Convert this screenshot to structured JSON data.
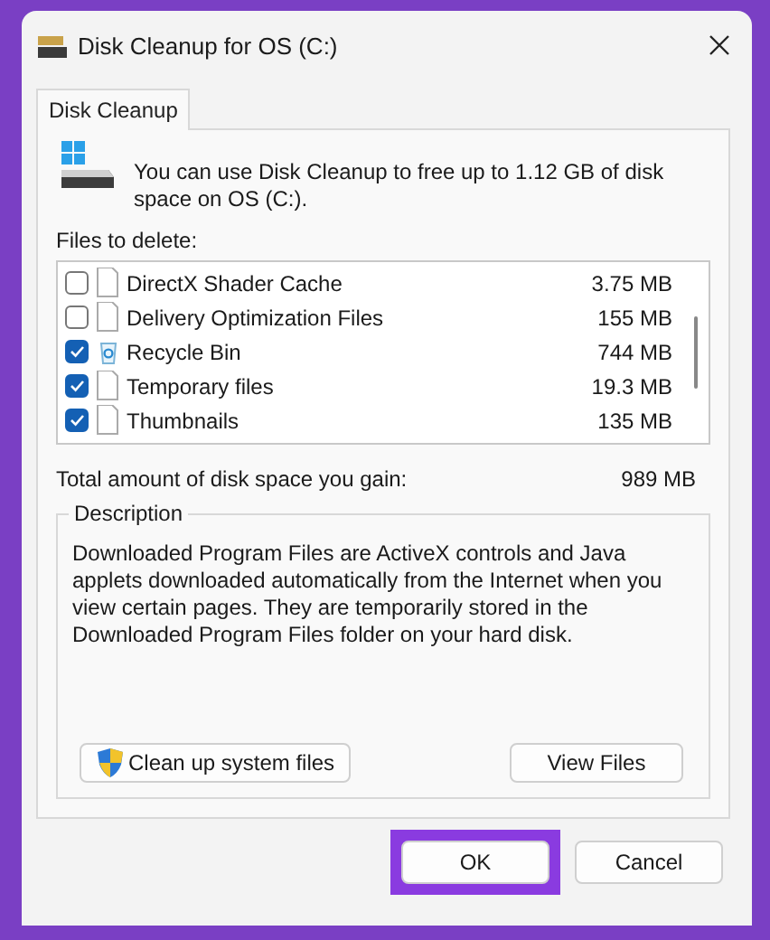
{
  "window": {
    "title": "Disk Cleanup for OS (C:)"
  },
  "tabs": [
    {
      "label": "Disk Cleanup",
      "selected": true
    }
  ],
  "intro": "You can use Disk Cleanup to free up to 1.12 GB of disk space on OS (C:).",
  "files_label": "Files to delete:",
  "files": [
    {
      "name": "DirectX Shader Cache",
      "size": "3.75 MB",
      "checked": false,
      "kind": "file"
    },
    {
      "name": "Delivery Optimization Files",
      "size": "155 MB",
      "checked": false,
      "kind": "file"
    },
    {
      "name": "Recycle Bin",
      "size": "744 MB",
      "checked": true,
      "kind": "recycle"
    },
    {
      "name": "Temporary files",
      "size": "19.3 MB",
      "checked": true,
      "kind": "file"
    },
    {
      "name": "Thumbnails",
      "size": "135 MB",
      "checked": true,
      "kind": "file"
    }
  ],
  "total": {
    "label": "Total amount of disk space you gain:",
    "value": "989 MB"
  },
  "description": {
    "title": "Description",
    "text": "Downloaded Program Files are ActiveX controls and Java applets downloaded automatically from the Internet when you view certain pages. They are temporarily stored in the Downloaded Program Files folder on your hard disk."
  },
  "panel_buttons": [
    {
      "label": "Clean up system files",
      "kind": "shield"
    },
    {
      "label": "View Files",
      "kind": "plain"
    }
  ],
  "dialog_buttons": [
    {
      "label": "OK",
      "highlighted": true
    },
    {
      "label": "Cancel",
      "highlighted": false
    }
  ]
}
